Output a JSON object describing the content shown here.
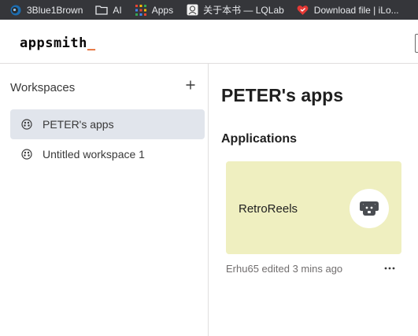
{
  "bookmarks": [
    {
      "label": "3Blue1Brown",
      "icon": "3blue1brown-icon"
    },
    {
      "label": "AI",
      "icon": "folder-icon"
    },
    {
      "label": "Apps",
      "icon": "apps-grid-icon"
    },
    {
      "label": "关于本书 — LQLab",
      "icon": "lqlab-icon"
    },
    {
      "label": "Download file | iLo...",
      "icon": "heart-icon"
    }
  ],
  "header": {
    "logo_text": "appsmith",
    "logo_cursor": "_"
  },
  "sidebar": {
    "title": "Workspaces",
    "add_icon": "plus-icon",
    "items": [
      {
        "label": "PETER's apps",
        "active": true,
        "icon": "workspace-icon"
      },
      {
        "label": "Untitled workspace 1",
        "active": false,
        "icon": "workspace-icon"
      }
    ]
  },
  "main": {
    "title": "PETER's apps",
    "section_title": "Applications",
    "apps": [
      {
        "name": "RetroReels",
        "card_color": "#efefc0",
        "icon": "dog-icon",
        "edited_text": "Erhu65 edited 3 mins ago"
      }
    ]
  },
  "colors": {
    "accent": "#e15615",
    "active_item_bg": "#e1e5ec",
    "bookmarks_bg": "#35363a"
  }
}
